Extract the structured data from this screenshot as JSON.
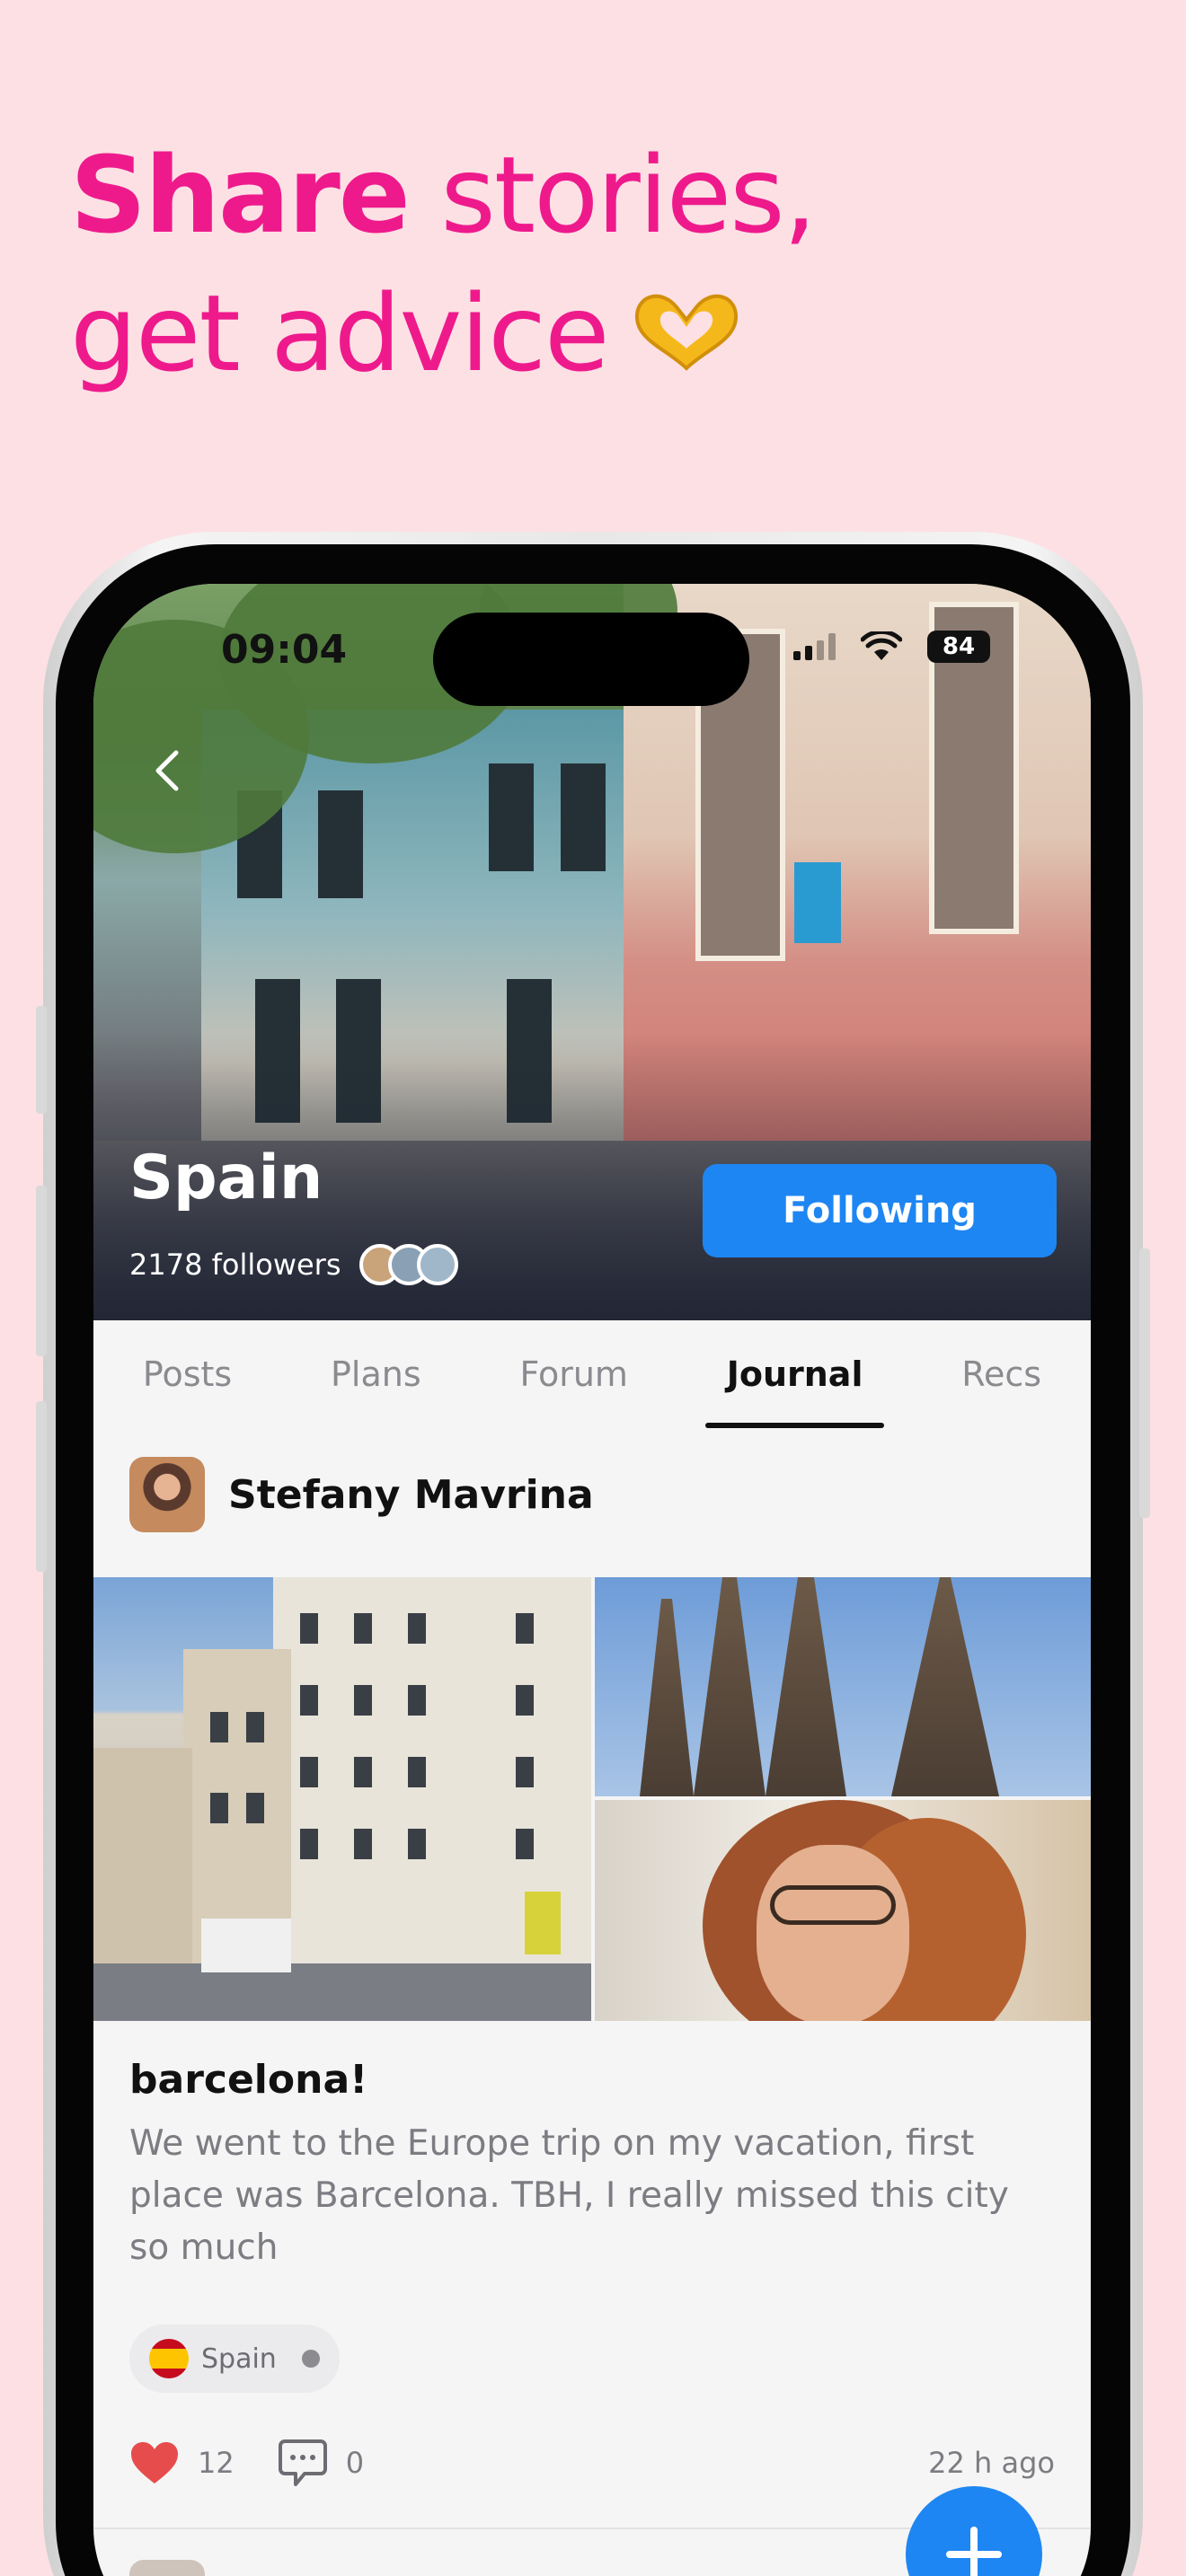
{
  "headline": {
    "strong": "Share",
    "rest_line1": " stories,",
    "line2": "get advice",
    "emoji_icon": "heart-hands-icon"
  },
  "status_bar": {
    "time": "09:04",
    "battery": "84"
  },
  "community": {
    "name": "Spain",
    "followers": "2178 followers",
    "follow_button": "Following"
  },
  "tabs": [
    {
      "label": "Posts",
      "active": false
    },
    {
      "label": "Plans",
      "active": false
    },
    {
      "label": "Forum",
      "active": false
    },
    {
      "label": "Journal",
      "active": true
    },
    {
      "label": "Recs",
      "active": false
    }
  ],
  "post": {
    "author": "Stefany Mavrina",
    "title": "barcelona!",
    "body": "We went to the Europe trip on my vacation, first place was Barcelona. TBH, I really missed this city so much",
    "tag": "Spain",
    "likes": "12",
    "comments": "0",
    "time": "22 h ago"
  },
  "colors": {
    "accent_pink": "#ee1a8c",
    "background": "#fde0e4",
    "primary_blue": "#1e86f2",
    "like_red": "#e74c4c"
  }
}
